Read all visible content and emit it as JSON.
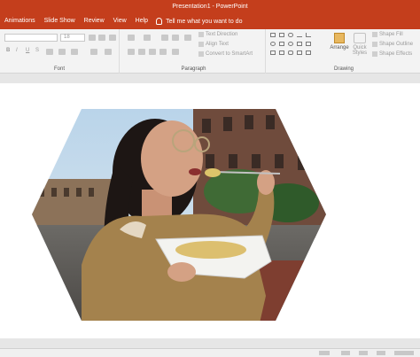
{
  "window": {
    "title": "Presentation1 - PowerPoint"
  },
  "tabs": [
    "Animations",
    "Slide Show",
    "Review",
    "View",
    "Help"
  ],
  "tell_me": "Tell me what you want to do",
  "ribbon": {
    "font": {
      "label": "Font",
      "size": "18"
    },
    "paragraph": {
      "label": "Paragraph",
      "text_direction": "Text Direction",
      "align_text": "Align Text",
      "convert_smartart": "Convert to SmartArt"
    },
    "drawing": {
      "label": "Drawing",
      "arrange": "Arrange",
      "quick_styles": "Quick Styles",
      "shape_fill": "Shape Fill",
      "shape_outline": "Shape Outline",
      "shape_effects": "Shape Effects"
    }
  },
  "slide": {
    "image_description": "Woman eating food from a takeaway tray on a street",
    "shape": "hexagon",
    "colors": {
      "ribbon_accent": "#c43e1c"
    }
  }
}
